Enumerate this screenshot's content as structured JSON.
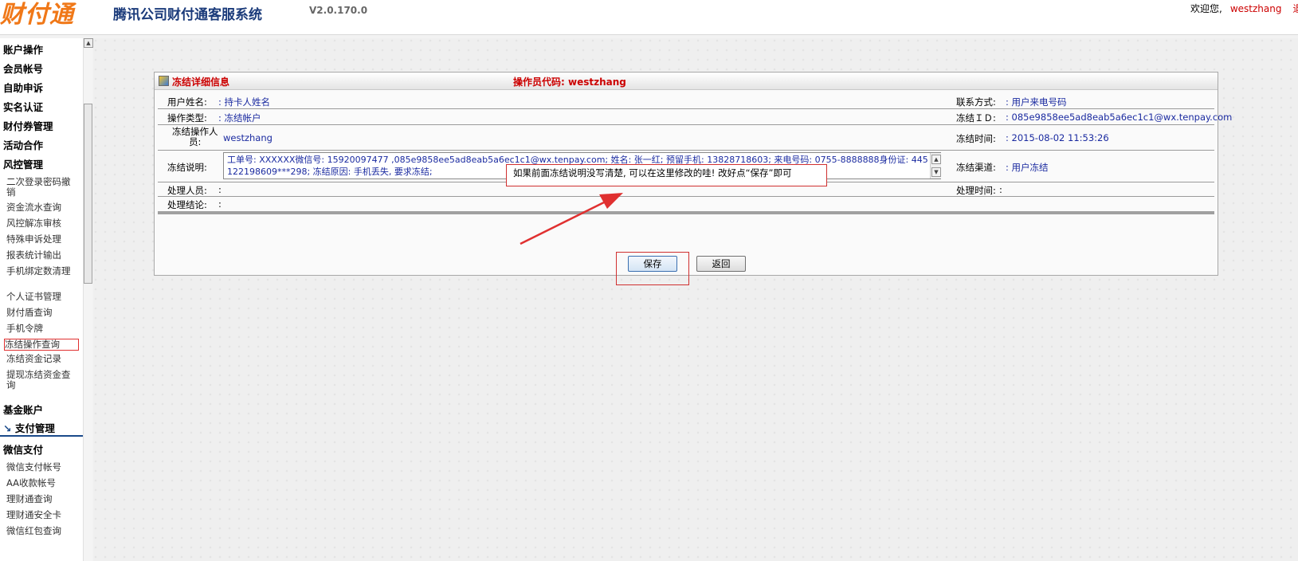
{
  "header": {
    "logo_text": "财付通",
    "system_title": "腾讯公司财付通客服系统",
    "version": "V2.0.170.0",
    "welcome_label": "欢迎您,",
    "username": "westzhang",
    "extra": "退"
  },
  "sidebar": {
    "sections_top": [
      "账户操作",
      "会员帐号",
      "自助申诉",
      "实名认证",
      "财付券管理",
      "活动合作",
      "风控管理"
    ],
    "risk_items": [
      "二次登录密码撤销",
      "资金流水查询",
      "风控解冻审核",
      "特殊申诉处理",
      "报表统计输出",
      "手机绑定数清理",
      "个人证书管理",
      "财付盾查询",
      "手机令牌",
      "冻结操作查询",
      "冻结资金记录",
      "提现冻结资金查询"
    ],
    "fund_account": "基金账户",
    "pay_management": "支付管理",
    "pay_arrow": "↘",
    "wechat_pay": "微信支付",
    "wechat_items": [
      "微信支付帐号",
      "AA收款帐号",
      "理财通查询",
      "理财通安全卡",
      "微信红包查询"
    ]
  },
  "panel": {
    "title": "冻结详细信息",
    "operator_code_label": "操作员代码:",
    "operator_code": "westzhang",
    "rows": {
      "username_label": "用户姓名:",
      "username_value": ": 持卡人姓名",
      "contact_label": "联系方式:",
      "contact_value": ": 用户来电号码",
      "optype_label": "操作类型:",
      "optype_value": ": 冻结帐户",
      "freeze_id_label": "冻结ＩＤ:",
      "freeze_id_value": ": 085e9858ee5ad8eab5a6ec1c1@wx.tenpay.com",
      "freeze_operator_label_1": "冻结操作人",
      "freeze_operator_label_2": "员:",
      "freeze_operator_value": "westzhang",
      "freeze_time_label": "冻结时间:",
      "freeze_time_value": ": 2015-08-02 11:53:26",
      "desc_label": "冻结说明:",
      "desc_value": "工单号: XXXXXX微信号: 15920097477 ,085e9858ee5ad8eab5a6ec1c1@wx.tenpay.com; 姓名: 张一红; 预留手机: 13828718603; 来电号码: 0755-8888888身份证: 445122198609***298; 冻结原因: 手机丢失, 要求冻结;",
      "channel_label": "冻结渠道:",
      "channel_value": ": 用户冻结",
      "handler_label": "处理人员:",
      "handler_value": ":",
      "handle_time_label": "处理时间:",
      "handle_time_value": ":",
      "result_label": "处理结论:",
      "result_value": ":"
    },
    "note": "如果前面冻结说明没写清楚, 可以在这里修改的哇! 改好点“保存”即可",
    "save_label": "保存",
    "back_label": "返回"
  },
  "colors": {
    "accent_red": "#cc0000",
    "value_blue": "#1a2aa0",
    "nav_blue": "#1a4a8a"
  },
  "icons": [
    "panel-title-icon",
    "scroll-up-arrow-icon",
    "scroll-down-arrow-icon",
    "annotation-arrow-icon"
  ]
}
